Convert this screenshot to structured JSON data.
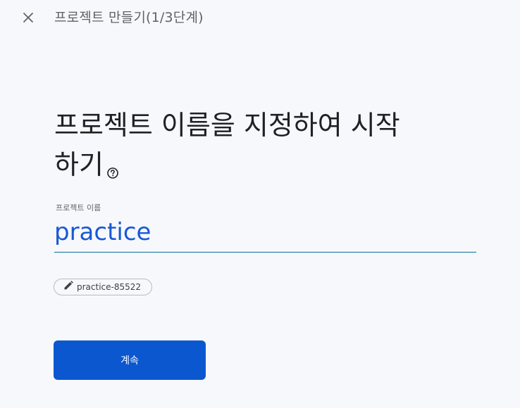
{
  "header": {
    "close_icon": "close-icon",
    "title": "프로젝트 만들기(1/3단계)"
  },
  "main": {
    "heading": "프로젝트 이름을 지정하여 시작하기",
    "help_icon": "help-icon",
    "project_name": {
      "label": "프로젝트 이름",
      "value": "practice"
    },
    "project_id_chip": {
      "icon": "edit-icon",
      "text": "practice-85522"
    },
    "continue_label": "계속"
  },
  "colors": {
    "background": "#f6f8fc",
    "accent": "#0b57d0",
    "input_text": "#1a57d4"
  }
}
